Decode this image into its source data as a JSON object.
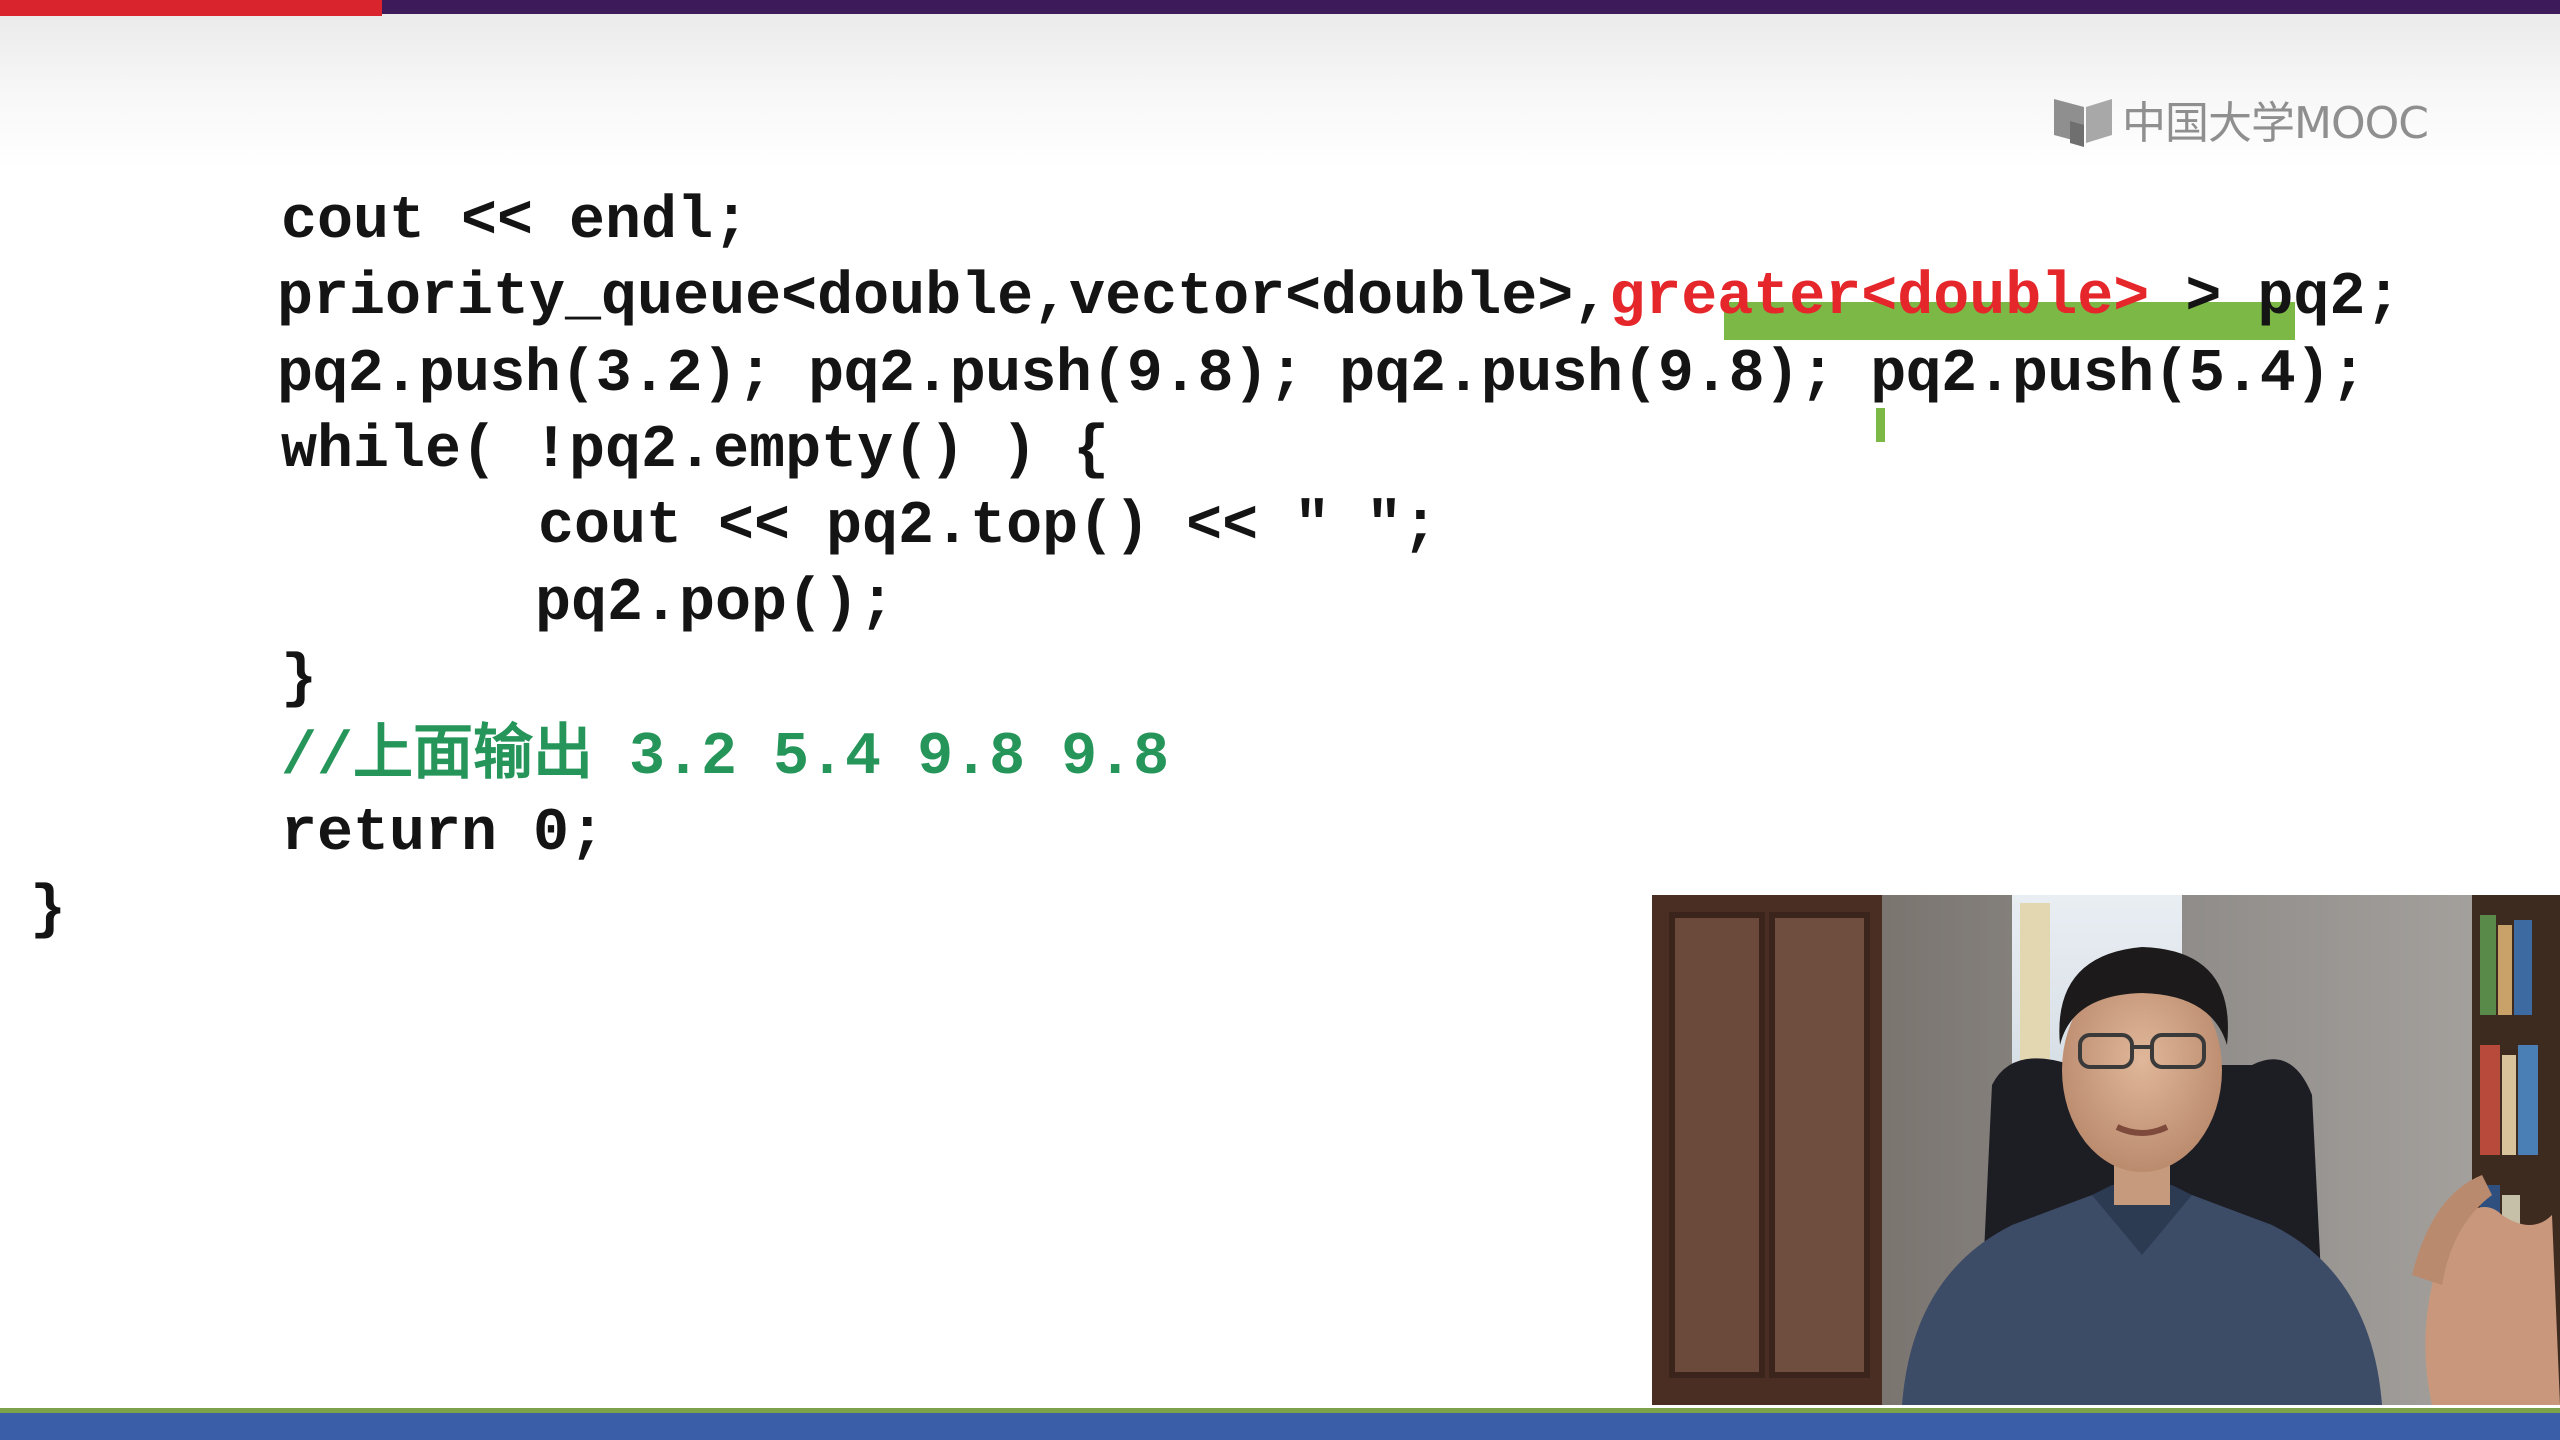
{
  "brand": {
    "logo_text": "中国大学MOOC",
    "logo_icon": "book-icon"
  },
  "code_lines": [
    "cout << endl;",
    "priority_queue<double,vector<double>,",
    "greater<double>",
    " > pq2;",
    "pq2.push(3.2); pq2.push(9.8); pq2.push(9.8); pq2.push(5.4);",
    "while( !pq2.empty() ) {",
    "cout << pq2.top() << \" \";",
    "pq2.pop();",
    "}",
    "//上面输出 3.2 5.4 9.8 9.8",
    "return 0;",
    "}"
  ],
  "colors": {
    "top_bar_red": "#d9232d",
    "top_bar_purple": "#3d1a5a",
    "highlight_red": "#e5262b",
    "comment_green": "#25955a",
    "underline_green": "#7cb846",
    "bottom_bar_blue": "#3b5ea8"
  },
  "video": {
    "subject": "lecturer-video-feed"
  }
}
